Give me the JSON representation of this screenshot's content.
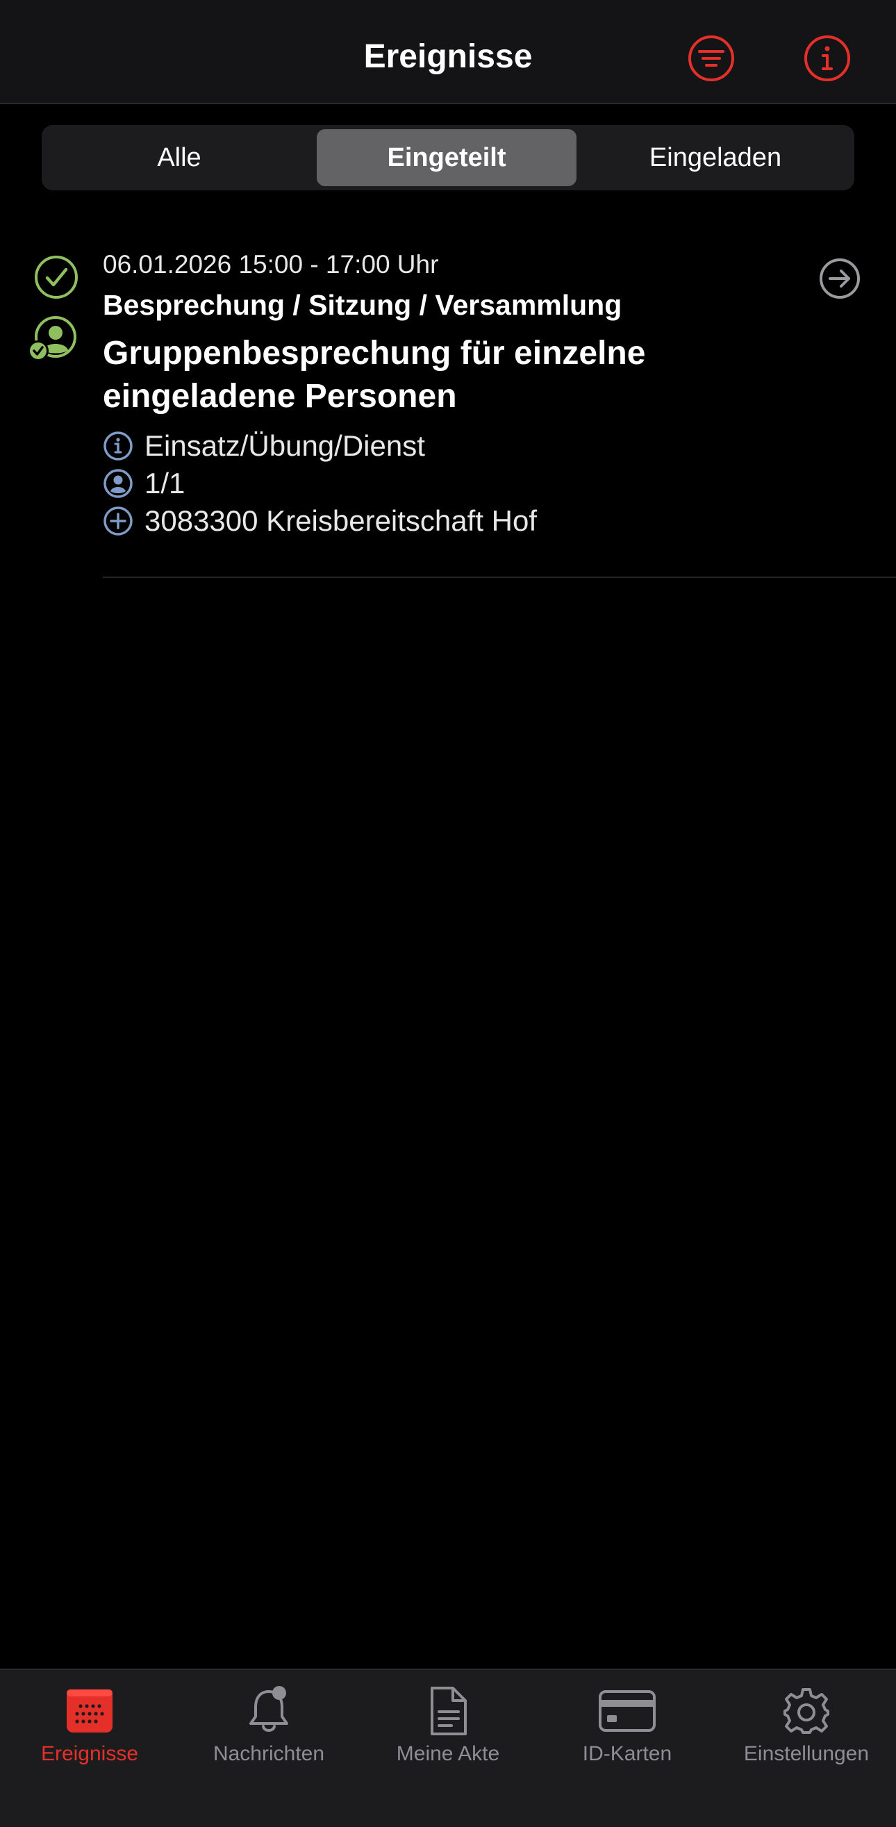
{
  "header": {
    "title": "Ereignisse",
    "filter_icon": "filter-lines-icon",
    "info_icon": "info-circle-icon",
    "accent_color": "#e5302a"
  },
  "segments": {
    "items": [
      "Alle",
      "Eingeteilt",
      "Eingeladen"
    ],
    "selected": "Eingeteilt"
  },
  "event": {
    "date_time": "06.01.2026 15:00 - 17:00 Uhr",
    "category": "Besprechung / Sitzung / Versammlung",
    "title": "Gruppenbesprechung für einzelne eingeladene Personen",
    "type": "Einsatz/Übung/Dienst",
    "participants": "1/1",
    "organization": "3083300 Kreisbereitschaft Hof",
    "status_color": "#8fbf5f",
    "detail_icon_color": "#7f9cc6"
  },
  "tabbar": {
    "items": [
      "Ereignisse",
      "Nachrichten",
      "Meine Akte",
      "ID-Karten",
      "Einstellungen"
    ],
    "active": "Ereignisse"
  }
}
